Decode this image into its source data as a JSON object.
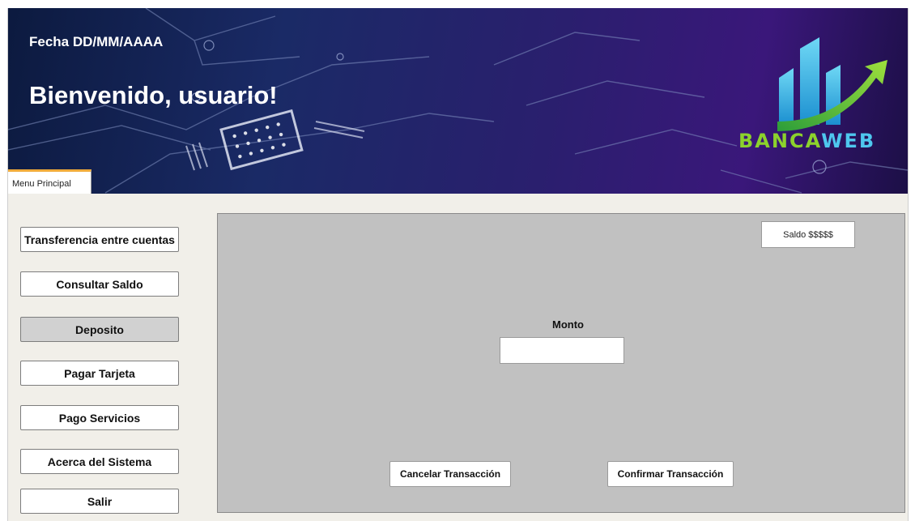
{
  "header": {
    "date": "Fecha DD/MM/AAAA",
    "welcome": "Bienvenido, usuario!",
    "brand_part1": "BANCA",
    "brand_part2": "WEB",
    "brand_colors": {
      "green": "#8cd22c",
      "blue": "#4ec7ee"
    }
  },
  "tabs": [
    {
      "label": "Menu Principal",
      "active": true
    }
  ],
  "sidebar": {
    "items": [
      {
        "label": "Transferencia entre cuentas",
        "active": false
      },
      {
        "label": "Consultar Saldo",
        "active": false
      },
      {
        "label": "Deposito",
        "active": true
      },
      {
        "label": "Pagar Tarjeta",
        "active": false
      },
      {
        "label": "Pago Servicios",
        "active": false
      },
      {
        "label": "Acerca del Sistema",
        "active": false
      },
      {
        "label": "Salir",
        "active": false
      }
    ]
  },
  "main": {
    "balance": "Saldo $$$$$",
    "amount_label": "Monto",
    "amount_value": "",
    "cancel_label": "Cancelar Transacción",
    "confirm_label": "Confirmar Transacción"
  },
  "colors": {
    "tab_accent": "#f0ab3a",
    "panel_bg": "#c1c1c1",
    "sidebar_bg": "#f1efe9"
  }
}
